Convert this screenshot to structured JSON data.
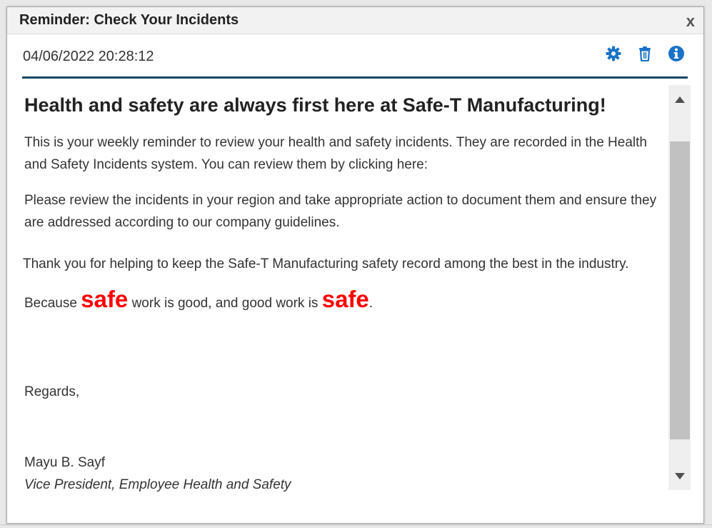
{
  "dialog": {
    "title": "Reminder: Check Your Incidents",
    "close_label": "x",
    "timestamp": "04/06/2022 20:28:12",
    "toolbar": {
      "icons": [
        "gear-icon",
        "trash-icon",
        "info-icon"
      ],
      "accent_color": "#1a73c8"
    },
    "divider_color": "#1b4664"
  },
  "message": {
    "heading": "Health and safety are always first here at Safe-T Manufacturing!",
    "paragraph1": "This is your weekly reminder to review your health and safety incidents. They are recorded in the Health and Safety Incidents system. You can review them by clicking here:",
    "paragraph2": "Please review the incidents in your region and take appropriate action to document them and ensure they are addressed according to our company guidelines.",
    "paragraph3": "Thank you for helping to keep the Safe-T Manufacturing safety record among the best in the industry.",
    "slogan": {
      "part1": "Because ",
      "highlight1": "safe",
      "part2": " work is good, and good work is ",
      "highlight2": "safe",
      "part3": ".",
      "highlight_color": "#ff0000"
    },
    "closing": "Regards,",
    "signature_name": "Mayu B. Sayf",
    "signature_title": "Vice President, Employee Health and Safety"
  }
}
